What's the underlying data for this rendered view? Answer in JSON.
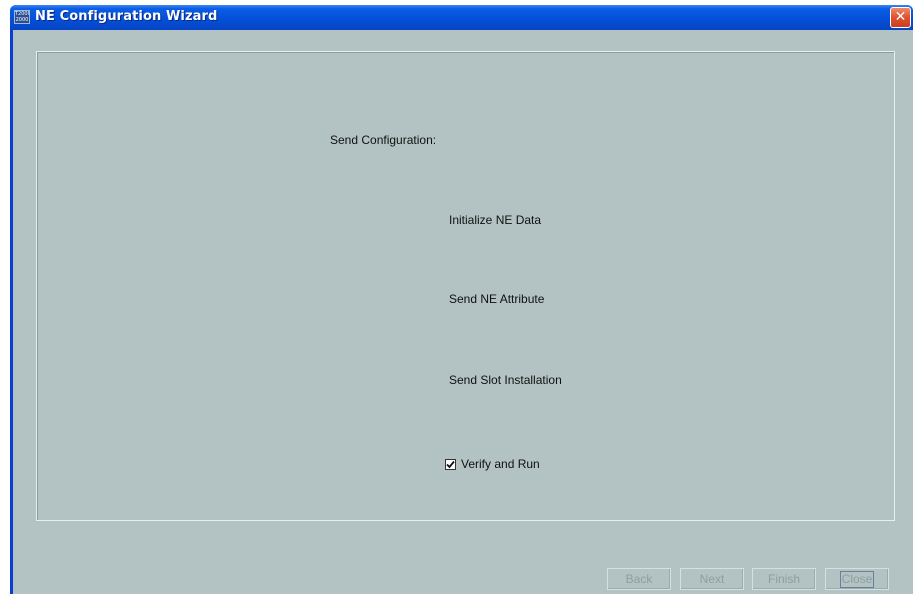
{
  "window": {
    "title": "NE Configuration Wizard",
    "icon_text_top": "T2000",
    "icon_text_bottom": "2000",
    "close_label": "✕"
  },
  "content": {
    "heading": "Send Configuration:",
    "steps": [
      "Initialize NE Data",
      "Send NE Attribute",
      "Send Slot Installation"
    ],
    "verify": {
      "label": "Verify and Run",
      "checked": true
    }
  },
  "buttons": {
    "back": "Back",
    "next": "Next",
    "finish": "Finish",
    "close": "Close"
  },
  "colors": {
    "titlebar": "#0550d8",
    "client_background": "#b3c3c3",
    "disabled_text": "#8e9e9e"
  }
}
